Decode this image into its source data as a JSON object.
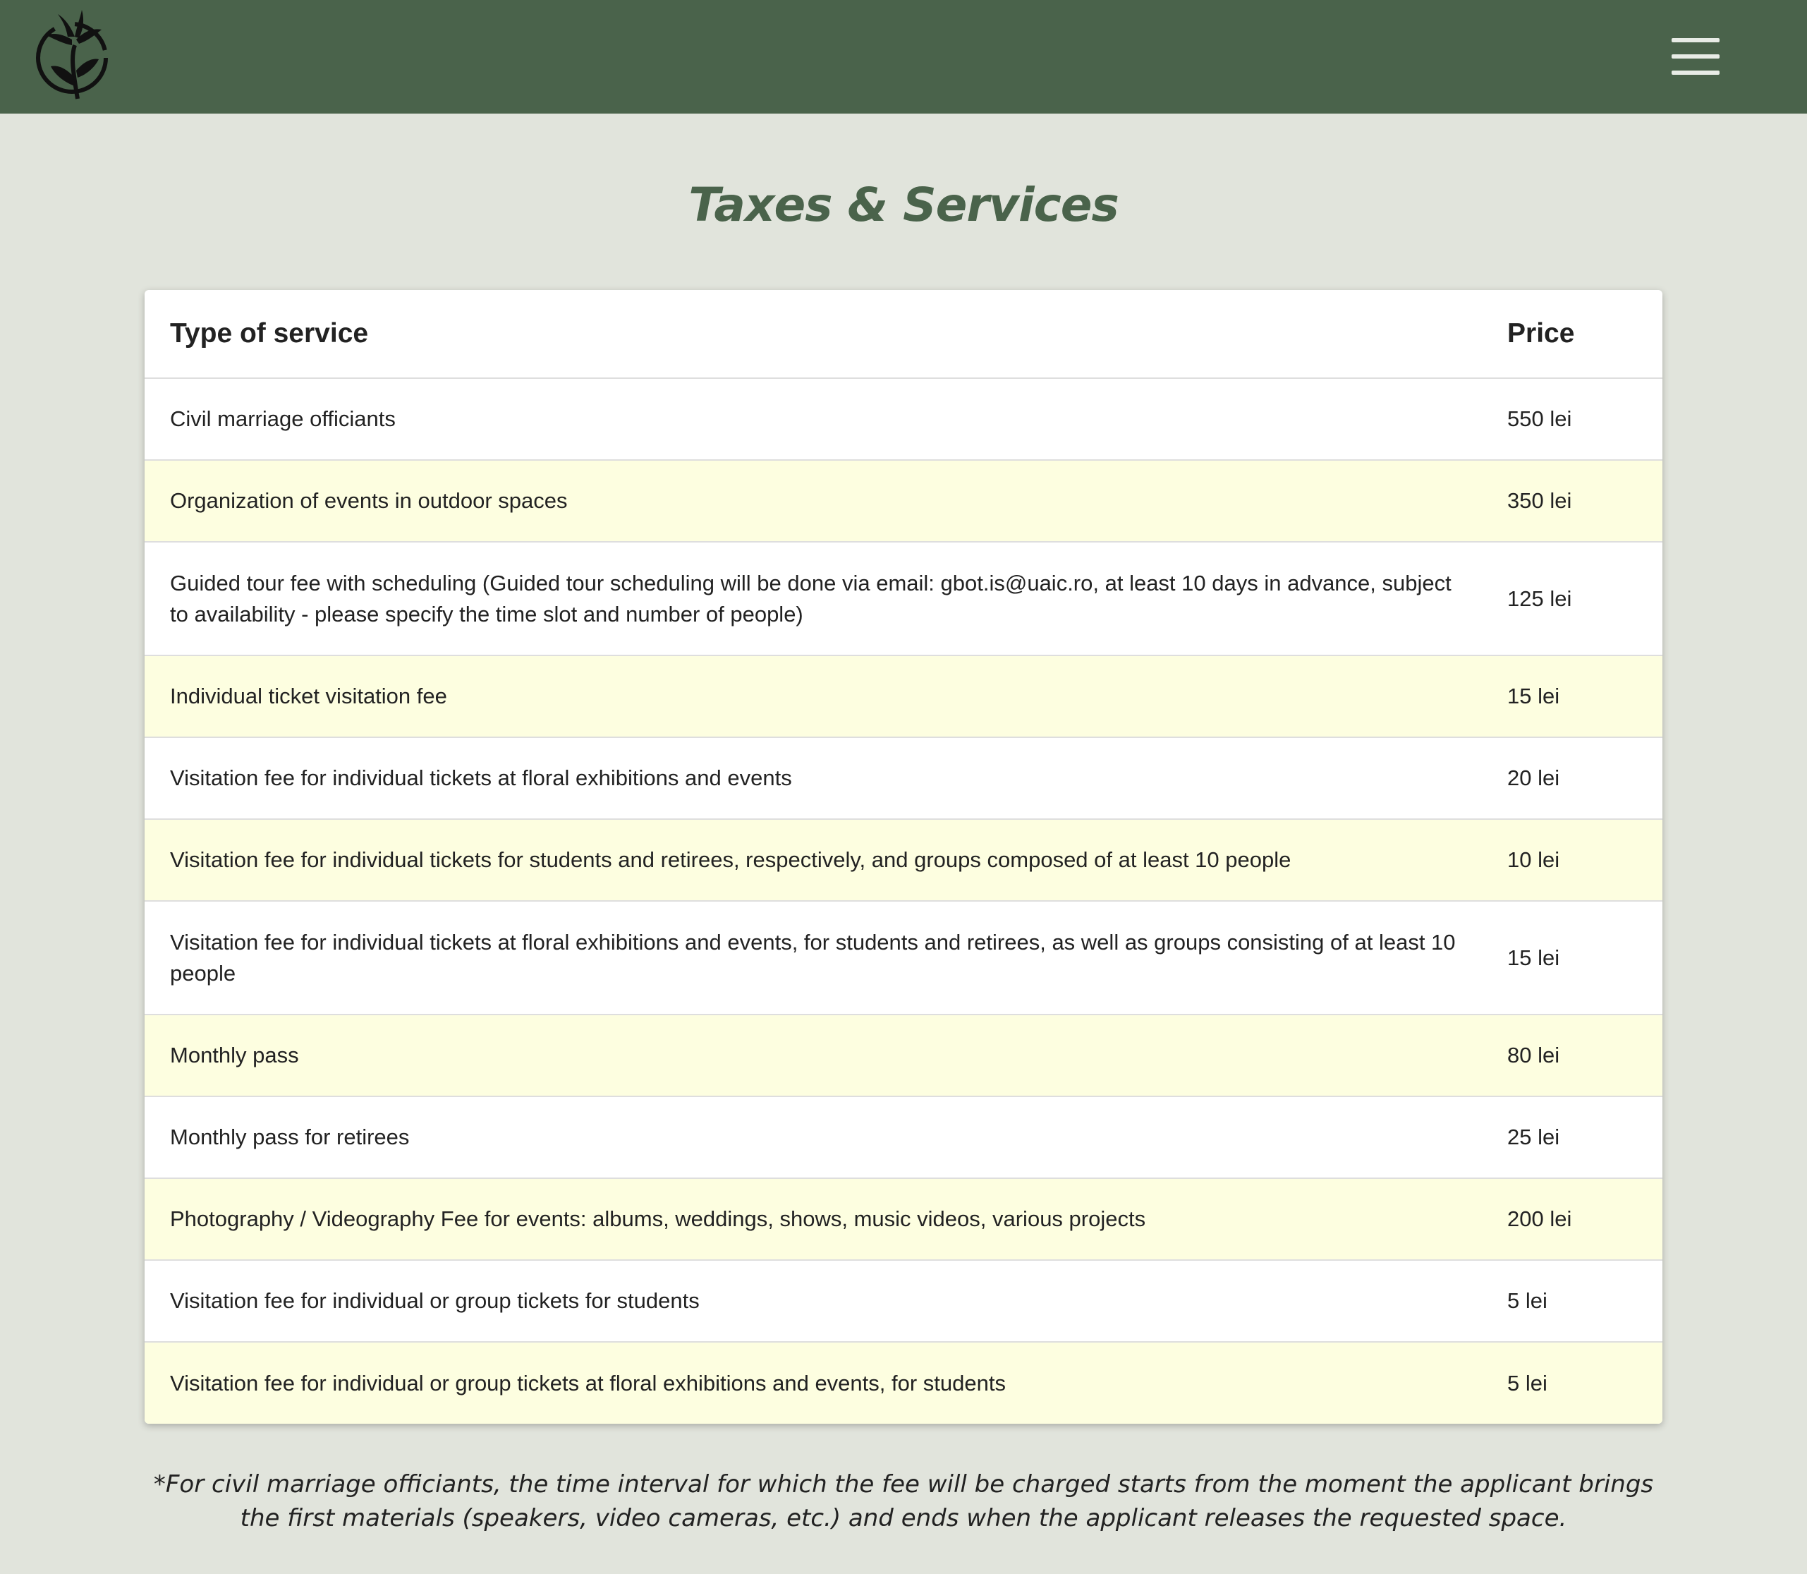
{
  "header": {
    "logo_icon": "lily-flower-logo-icon",
    "menu_icon": "hamburger-menu-icon",
    "background_color": "#4a634b"
  },
  "page_title": "Taxes & Services",
  "table": {
    "headers": {
      "service": "Type of service",
      "price": "Price"
    },
    "rows": [
      {
        "service": "Civil marriage officiants",
        "price": "550 lei"
      },
      {
        "service": "Organization of events in outdoor spaces",
        "price": "350 lei"
      },
      {
        "service": "Guided tour fee with scheduling (Guided tour scheduling will be done via email: gbot.is@uaic.ro, at least 10 days in advance, subject to availability - please specify the time slot and number of people)",
        "price": "125 lei"
      },
      {
        "service": "Individual ticket visitation fee",
        "price": "15 lei"
      },
      {
        "service": "Visitation fee for individual tickets at floral exhibitions and events",
        "price": "20 lei"
      },
      {
        "service": "Visitation fee for individual tickets for students and retirees, respectively, and groups composed of at least 10 people",
        "price": "10 lei"
      },
      {
        "service": "Visitation fee for individual tickets at floral exhibitions and events, for students and retirees, as well as groups consisting of at least 10 people",
        "price": "15 lei"
      },
      {
        "service": "Monthly pass",
        "price": "80 lei"
      },
      {
        "service": "Monthly pass for retirees",
        "price": "25 lei"
      },
      {
        "service": "Photography / Videography Fee for events: albums, weddings, shows, music videos, various projects",
        "price": "200 lei"
      },
      {
        "service": "Visitation fee for individual or group tickets for students",
        "price": "5 lei"
      },
      {
        "service": "Visitation fee for individual or group tickets at floral exhibitions and events, for students",
        "price": "5 lei"
      }
    ],
    "alternate_row_color": "#fdfee0"
  },
  "footnote": "*For civil marriage officiants, the time interval for which the fee will be charged starts from the moment the applicant brings the first materials (speakers, video cameras, etc.) and ends when the applicant releases the requested space."
}
